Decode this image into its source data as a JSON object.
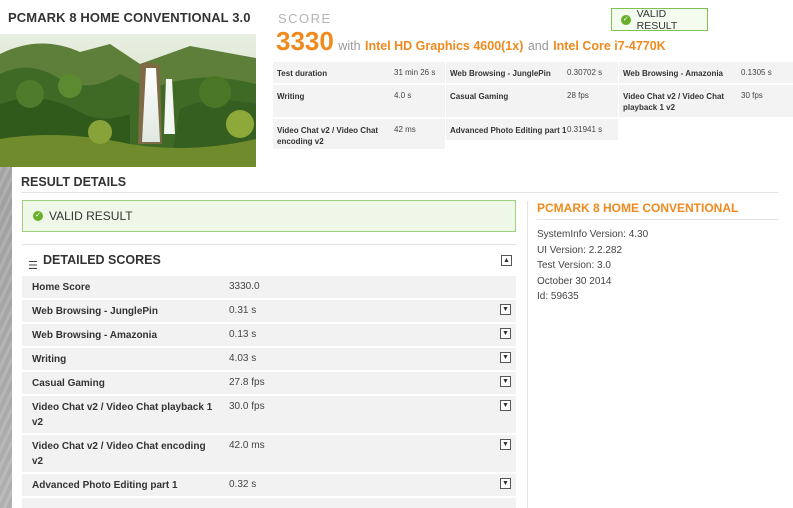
{
  "header": {
    "title": "PCMARK 8 HOME CONVENTIONAL 3.0"
  },
  "score": {
    "label": "SCORE",
    "value": "3330",
    "with_text": "with",
    "gpu": "Intel HD Graphics 4600(1x)",
    "and_text": "and",
    "cpu": "Intel Core i7-4770K",
    "valid_badge": "VALID RESULT"
  },
  "mini_stats": [
    {
      "key": "Test duration",
      "value": "31 min 26 s"
    },
    {
      "key": "Web Browsing - JunglePin",
      "value": "0.30702 s"
    },
    {
      "key": "Web Browsing - Amazonia",
      "value": "0.1305 s"
    },
    {
      "key": "Writing",
      "value": "4.0 s"
    },
    {
      "key": "Casual Gaming",
      "value": "28 fps"
    },
    {
      "key": "Video Chat v2 / Video Chat playback 1 v2",
      "value": "30 fps"
    },
    {
      "key": "Video Chat v2 / Video Chat encoding v2",
      "value": "42 ms"
    },
    {
      "key": "Advanced Photo Editing part 1",
      "value": "0.31941 s"
    }
  ],
  "details": {
    "title": "RESULT DETAILS",
    "valid_label": "VALID RESULT",
    "scores_title": "DETAILED SCORES",
    "rows": [
      {
        "name": "Home Score",
        "value": "3330.0",
        "expandable": false
      },
      {
        "name": "Web Browsing - JunglePin",
        "value": "0.31 s",
        "expandable": true
      },
      {
        "name": "Web Browsing - Amazonia",
        "value": "0.13 s",
        "expandable": true
      },
      {
        "name": "Writing",
        "value": "4.03 s",
        "expandable": true
      },
      {
        "name": "Casual Gaming",
        "value": "27.8 fps",
        "expandable": true
      },
      {
        "name": "Video Chat v2 / Video Chat playback 1 v2",
        "value": "30.0 fps",
        "expandable": true
      },
      {
        "name": "Video Chat v2 / Video Chat encoding v2",
        "value": "42.0 ms",
        "expandable": true
      },
      {
        "name": "Advanced Photo Editing part 1",
        "value": "0.32 s",
        "expandable": true
      }
    ]
  },
  "info_panel": {
    "title": "PCMARK 8 HOME CONVENTIONAL",
    "lines": [
      "SystemInfo Version: 4.30",
      "UI Version: 2.2.282",
      "Test Version: 3.0",
      "October 30 2014",
      "Id: 59635"
    ]
  },
  "colors": {
    "accent": "#f08a1e",
    "valid_green": "#6aaf2c"
  },
  "icons": {
    "valid": "check-circle-icon",
    "menu": "list-icon",
    "collapse": "chevron-up-icon",
    "expand": "chevron-down-icon"
  }
}
